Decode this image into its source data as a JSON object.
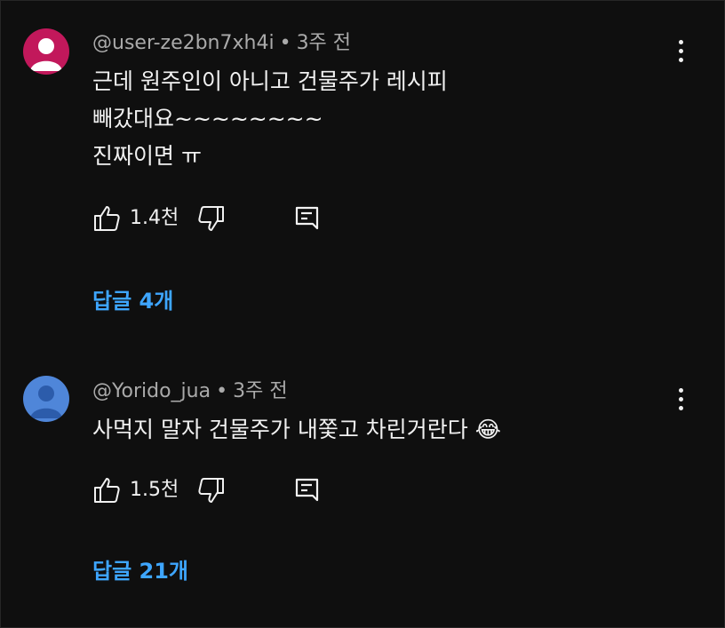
{
  "comments": [
    {
      "handle": "@user-ze2bn7xh4i",
      "time": "3주 전",
      "avatar_color": "#c2185b",
      "lines": [
        "근데 원주인이 아니고  건물주가 레시피",
        "빼갔대요~~~~~~~~",
        "진짜이면 ㅠ"
      ],
      "likes": "1.4천",
      "replies": "답글 4개"
    },
    {
      "handle": "@Yorido_jua",
      "time": "3주 전",
      "avatar_color": "#4f86d9",
      "lines": [
        "사먹지 말자 건물주가 내쫓고 차린거란다 😂"
      ],
      "likes": "1.5천",
      "replies": "답글 21개"
    }
  ],
  "separator": "•",
  "icons": {
    "like": "thumb-up-icon",
    "dislike": "thumb-down-icon",
    "reply": "reply-icon",
    "more": "more-vert-icon"
  },
  "colors": {
    "background": "#0f0f0f",
    "text": "#f1f1f1",
    "meta": "#aaaaaa",
    "link": "#3ea6ff"
  }
}
